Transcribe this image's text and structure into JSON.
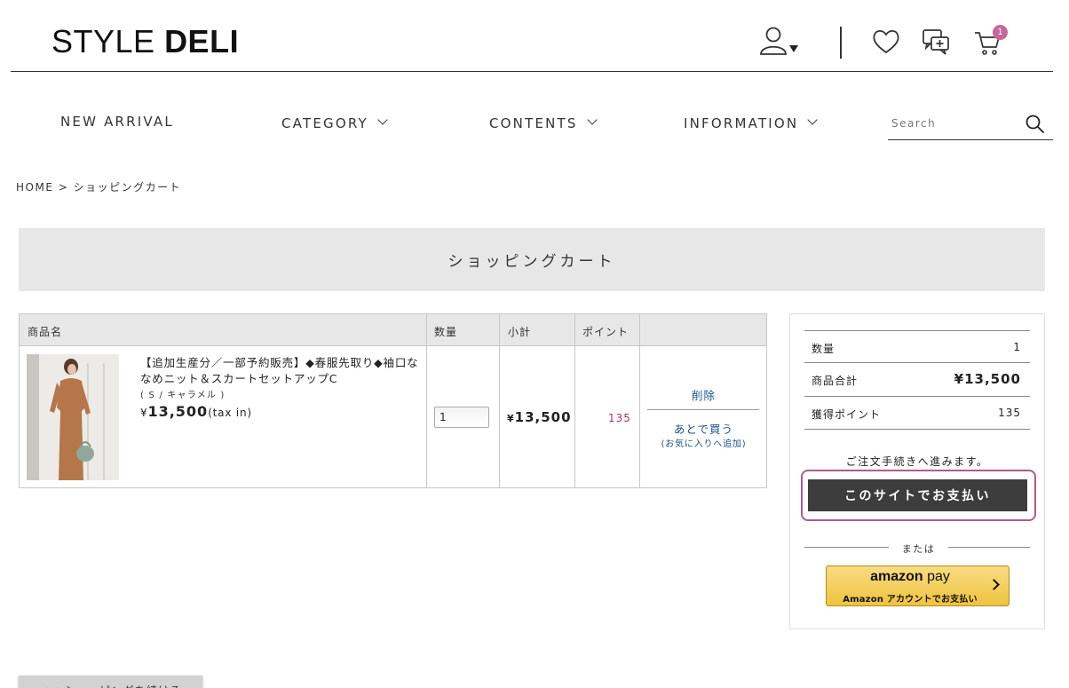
{
  "header": {
    "logo_light": "STYLE",
    "logo_bold": "DELI",
    "cart_count": "1",
    "icons": [
      "user-icon",
      "heart-icon",
      "chat-icon",
      "cart-icon"
    ]
  },
  "nav": {
    "items": [
      {
        "label": "NEW ARRIVAL"
      },
      {
        "label": "CATEGORY"
      },
      {
        "label": "CONTENTS"
      },
      {
        "label": "INFORMATION"
      }
    ],
    "search_placeholder": "Search"
  },
  "breadcrumb": "HOME > ショッピングカート",
  "page_title": "ショッピングカート",
  "cart": {
    "headers": [
      "商品名",
      "数量",
      "小計",
      "ポイント"
    ],
    "items": [
      {
        "name": "【追加生産分／一部予約販売】◆春服先取り◆袖口ななめニット＆スカートセットアップC",
        "variant": "( S / キャラメル )",
        "price_yen": "¥",
        "price": "13,500",
        "tax": "(tax in)",
        "quantity": "1",
        "subtotal_yen": "¥",
        "subtotal": "13,500",
        "points": "135",
        "delete_label": "削除",
        "later_label": "あとで買う",
        "later_sub": "(お気に入りへ追加)"
      }
    ]
  },
  "summary": {
    "rows": [
      {
        "label": "数量",
        "value": "1"
      },
      {
        "label": "商品合計",
        "value": "¥13,500"
      },
      {
        "label": "獲得ポイント",
        "value": "135"
      }
    ],
    "proceed_note": "ご注文手続きへ進みます。",
    "pay_button": "このサイトでお支払い",
    "or_text": "または",
    "amazon_logo_a": "amazon",
    "amazon_logo_b": "pay",
    "amazon_sub": "Amazon アカウントでお支払い"
  },
  "continue_label": "<< ショッピングを続ける",
  "colors": {
    "accent": "#b25a8e",
    "badge": "#c9659a",
    "link": "#1a4f8f",
    "points": "#b0306a",
    "pay_button": "#3d3d3d",
    "title_bar": "#e8e7e7"
  }
}
